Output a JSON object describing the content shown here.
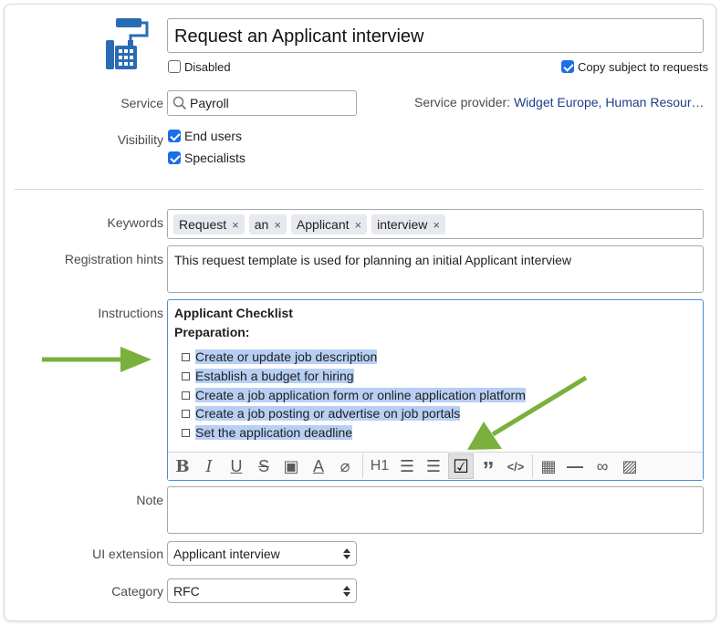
{
  "header": {
    "title": "Request an Applicant interview",
    "disabled_label": "Disabled",
    "disabled_checked": false,
    "copy_subject_label": "Copy subject to requests",
    "copy_subject_checked": true
  },
  "service": {
    "label": "Service",
    "value": "Payroll",
    "provider_label": "Service provider:",
    "provider_value": "Widget Europe, Human Resour…"
  },
  "visibility": {
    "label": "Visibility",
    "options": [
      {
        "label": "End users",
        "checked": true
      },
      {
        "label": "Specialists",
        "checked": true
      }
    ]
  },
  "keywords": {
    "label": "Keywords",
    "items": [
      "Request",
      "an",
      "Applicant",
      "interview"
    ],
    "remove_glyph": "×"
  },
  "registration_hints": {
    "label": "Registration hints",
    "value": "This request template is used for planning an initial Applicant interview"
  },
  "instructions": {
    "label": "Instructions",
    "heading": "Applicant Checklist",
    "subheading": "Preparation:",
    "items": [
      "Create or update job description",
      "Establish a budget for hiring",
      "Create a job application form or online application platform",
      "Create a job posting or advertise on job portals",
      "Set the application deadline"
    ],
    "toolbar": [
      {
        "name": "bold",
        "glyph": "B"
      },
      {
        "name": "italic",
        "glyph": "I"
      },
      {
        "name": "underline",
        "glyph": "U"
      },
      {
        "name": "strikethrough",
        "glyph": "S"
      },
      {
        "name": "highlight",
        "glyph": "▣"
      },
      {
        "name": "text-color",
        "glyph": "A"
      },
      {
        "name": "clear-format",
        "glyph": "⌀"
      },
      {
        "name": "heading",
        "glyph": "H1"
      },
      {
        "name": "ordered-list",
        "glyph": "☰"
      },
      {
        "name": "bullet-list",
        "glyph": "☰"
      },
      {
        "name": "checklist",
        "glyph": "☑"
      },
      {
        "name": "quote",
        "glyph": "”"
      },
      {
        "name": "code",
        "glyph": "</>"
      },
      {
        "name": "table",
        "glyph": "▦"
      },
      {
        "name": "horizontal-rule",
        "glyph": "—"
      },
      {
        "name": "link",
        "glyph": "∞"
      },
      {
        "name": "image",
        "glyph": "▨"
      }
    ]
  },
  "note": {
    "label": "Note",
    "value": ""
  },
  "ui_extension": {
    "label": "UI extension",
    "value": "Applicant interview"
  },
  "category": {
    "label": "Category",
    "value": "RFC"
  },
  "colors": {
    "accent": "#1c6fe6",
    "highlight": "#b8cff4",
    "arrow": "#7ab03c",
    "icon_blue": "#2a6cb3",
    "link": "#1a3f8a"
  }
}
